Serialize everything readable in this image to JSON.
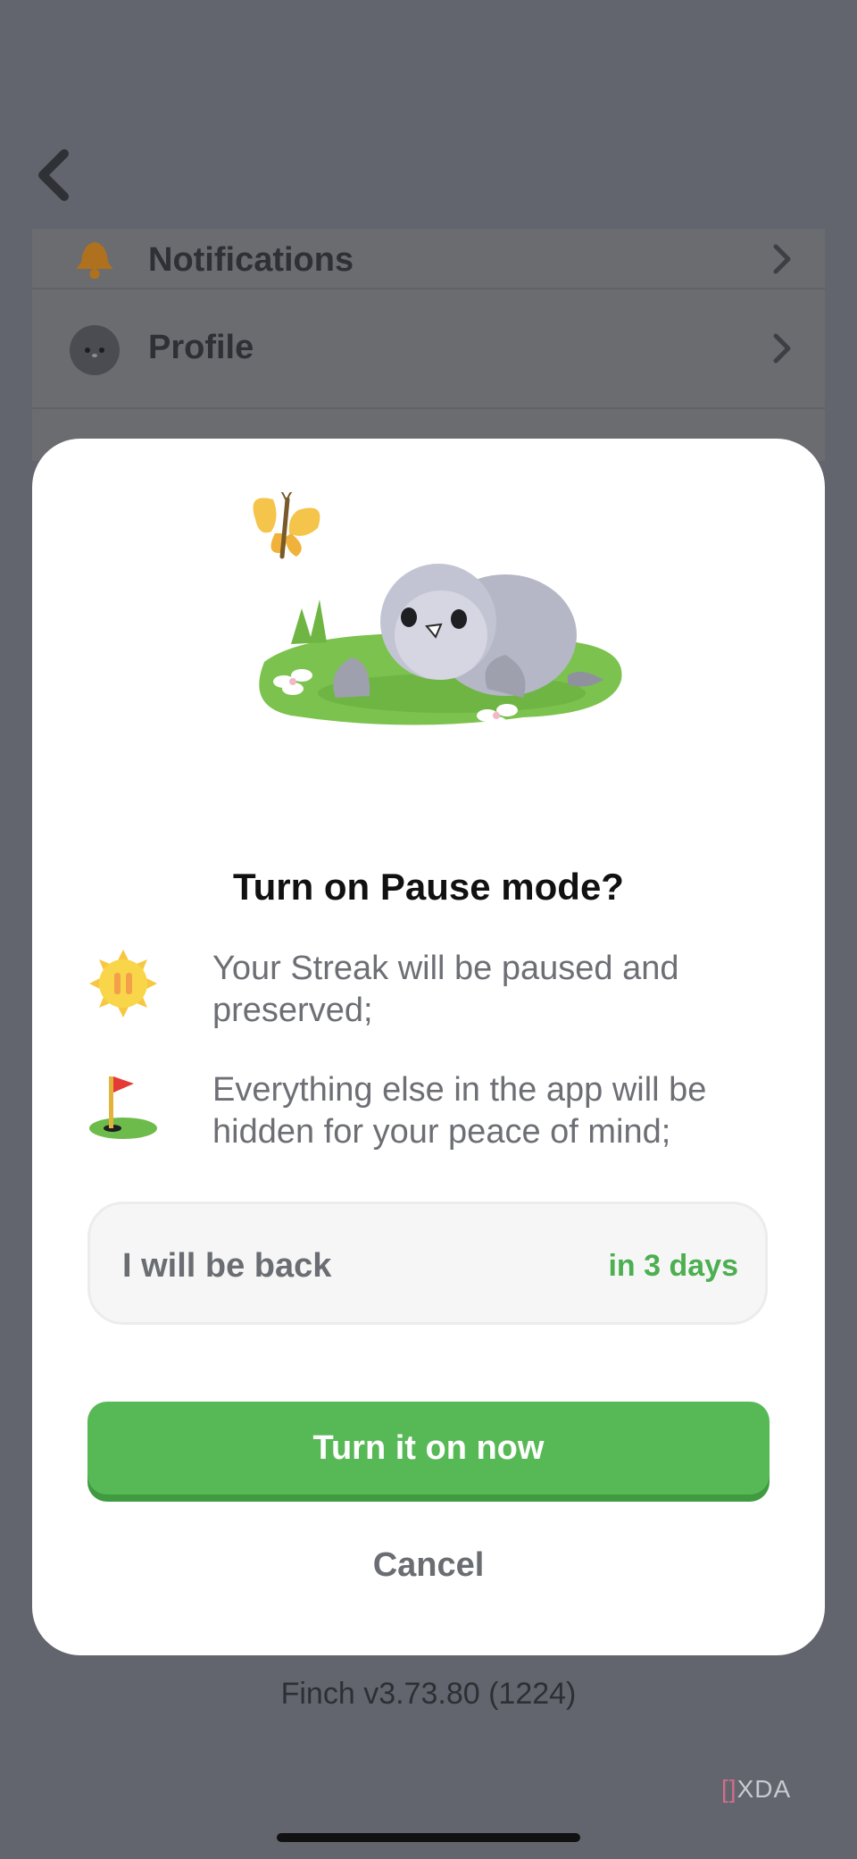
{
  "settings": {
    "items": [
      {
        "label": "Notifications",
        "icon": "bell-icon"
      },
      {
        "label": "Profile",
        "icon": "profile-avatar-icon"
      }
    ]
  },
  "modal": {
    "title_prefix": "Turn on ",
    "title_strong": "Pause mode?",
    "info": [
      {
        "text": "Your Streak will be paused and preserved;",
        "icon": "pause-sun-icon"
      },
      {
        "text": "Everything else in the app will be hidden for your peace of mind;",
        "icon": "golf-flag-icon"
      }
    ],
    "return_picker": {
      "label": "I will be back",
      "value": "in 3 days"
    },
    "primary_button": "Turn it on now",
    "cancel_button": "Cancel"
  },
  "footer": {
    "version": "Finch v3.73.80 (1224)"
  },
  "watermark": {
    "mark": "[]",
    "text": "XDA"
  },
  "colors": {
    "accent_green": "#57b956",
    "overlay": "#62656e"
  }
}
